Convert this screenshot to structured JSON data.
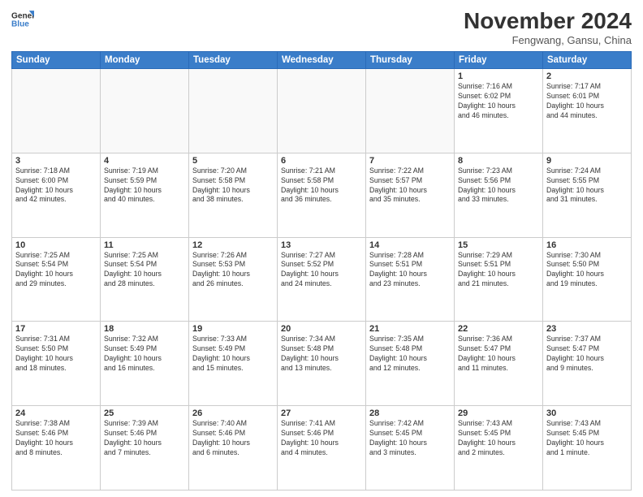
{
  "logo": {
    "line1": "General",
    "line2": "Blue"
  },
  "title": "November 2024",
  "location": "Fengwang, Gansu, China",
  "days_of_week": [
    "Sunday",
    "Monday",
    "Tuesday",
    "Wednesday",
    "Thursday",
    "Friday",
    "Saturday"
  ],
  "weeks": [
    [
      {
        "day": "",
        "info": ""
      },
      {
        "day": "",
        "info": ""
      },
      {
        "day": "",
        "info": ""
      },
      {
        "day": "",
        "info": ""
      },
      {
        "day": "",
        "info": ""
      },
      {
        "day": "1",
        "info": "Sunrise: 7:16 AM\nSunset: 6:02 PM\nDaylight: 10 hours\nand 46 minutes."
      },
      {
        "day": "2",
        "info": "Sunrise: 7:17 AM\nSunset: 6:01 PM\nDaylight: 10 hours\nand 44 minutes."
      }
    ],
    [
      {
        "day": "3",
        "info": "Sunrise: 7:18 AM\nSunset: 6:00 PM\nDaylight: 10 hours\nand 42 minutes."
      },
      {
        "day": "4",
        "info": "Sunrise: 7:19 AM\nSunset: 5:59 PM\nDaylight: 10 hours\nand 40 minutes."
      },
      {
        "day": "5",
        "info": "Sunrise: 7:20 AM\nSunset: 5:58 PM\nDaylight: 10 hours\nand 38 minutes."
      },
      {
        "day": "6",
        "info": "Sunrise: 7:21 AM\nSunset: 5:58 PM\nDaylight: 10 hours\nand 36 minutes."
      },
      {
        "day": "7",
        "info": "Sunrise: 7:22 AM\nSunset: 5:57 PM\nDaylight: 10 hours\nand 35 minutes."
      },
      {
        "day": "8",
        "info": "Sunrise: 7:23 AM\nSunset: 5:56 PM\nDaylight: 10 hours\nand 33 minutes."
      },
      {
        "day": "9",
        "info": "Sunrise: 7:24 AM\nSunset: 5:55 PM\nDaylight: 10 hours\nand 31 minutes."
      }
    ],
    [
      {
        "day": "10",
        "info": "Sunrise: 7:25 AM\nSunset: 5:54 PM\nDaylight: 10 hours\nand 29 minutes."
      },
      {
        "day": "11",
        "info": "Sunrise: 7:25 AM\nSunset: 5:54 PM\nDaylight: 10 hours\nand 28 minutes."
      },
      {
        "day": "12",
        "info": "Sunrise: 7:26 AM\nSunset: 5:53 PM\nDaylight: 10 hours\nand 26 minutes."
      },
      {
        "day": "13",
        "info": "Sunrise: 7:27 AM\nSunset: 5:52 PM\nDaylight: 10 hours\nand 24 minutes."
      },
      {
        "day": "14",
        "info": "Sunrise: 7:28 AM\nSunset: 5:51 PM\nDaylight: 10 hours\nand 23 minutes."
      },
      {
        "day": "15",
        "info": "Sunrise: 7:29 AM\nSunset: 5:51 PM\nDaylight: 10 hours\nand 21 minutes."
      },
      {
        "day": "16",
        "info": "Sunrise: 7:30 AM\nSunset: 5:50 PM\nDaylight: 10 hours\nand 19 minutes."
      }
    ],
    [
      {
        "day": "17",
        "info": "Sunrise: 7:31 AM\nSunset: 5:50 PM\nDaylight: 10 hours\nand 18 minutes."
      },
      {
        "day": "18",
        "info": "Sunrise: 7:32 AM\nSunset: 5:49 PM\nDaylight: 10 hours\nand 16 minutes."
      },
      {
        "day": "19",
        "info": "Sunrise: 7:33 AM\nSunset: 5:49 PM\nDaylight: 10 hours\nand 15 minutes."
      },
      {
        "day": "20",
        "info": "Sunrise: 7:34 AM\nSunset: 5:48 PM\nDaylight: 10 hours\nand 13 minutes."
      },
      {
        "day": "21",
        "info": "Sunrise: 7:35 AM\nSunset: 5:48 PM\nDaylight: 10 hours\nand 12 minutes."
      },
      {
        "day": "22",
        "info": "Sunrise: 7:36 AM\nSunset: 5:47 PM\nDaylight: 10 hours\nand 11 minutes."
      },
      {
        "day": "23",
        "info": "Sunrise: 7:37 AM\nSunset: 5:47 PM\nDaylight: 10 hours\nand 9 minutes."
      }
    ],
    [
      {
        "day": "24",
        "info": "Sunrise: 7:38 AM\nSunset: 5:46 PM\nDaylight: 10 hours\nand 8 minutes."
      },
      {
        "day": "25",
        "info": "Sunrise: 7:39 AM\nSunset: 5:46 PM\nDaylight: 10 hours\nand 7 minutes."
      },
      {
        "day": "26",
        "info": "Sunrise: 7:40 AM\nSunset: 5:46 PM\nDaylight: 10 hours\nand 6 minutes."
      },
      {
        "day": "27",
        "info": "Sunrise: 7:41 AM\nSunset: 5:46 PM\nDaylight: 10 hours\nand 4 minutes."
      },
      {
        "day": "28",
        "info": "Sunrise: 7:42 AM\nSunset: 5:45 PM\nDaylight: 10 hours\nand 3 minutes."
      },
      {
        "day": "29",
        "info": "Sunrise: 7:43 AM\nSunset: 5:45 PM\nDaylight: 10 hours\nand 2 minutes."
      },
      {
        "day": "30",
        "info": "Sunrise: 7:43 AM\nSunset: 5:45 PM\nDaylight: 10 hours\nand 1 minute."
      }
    ]
  ]
}
